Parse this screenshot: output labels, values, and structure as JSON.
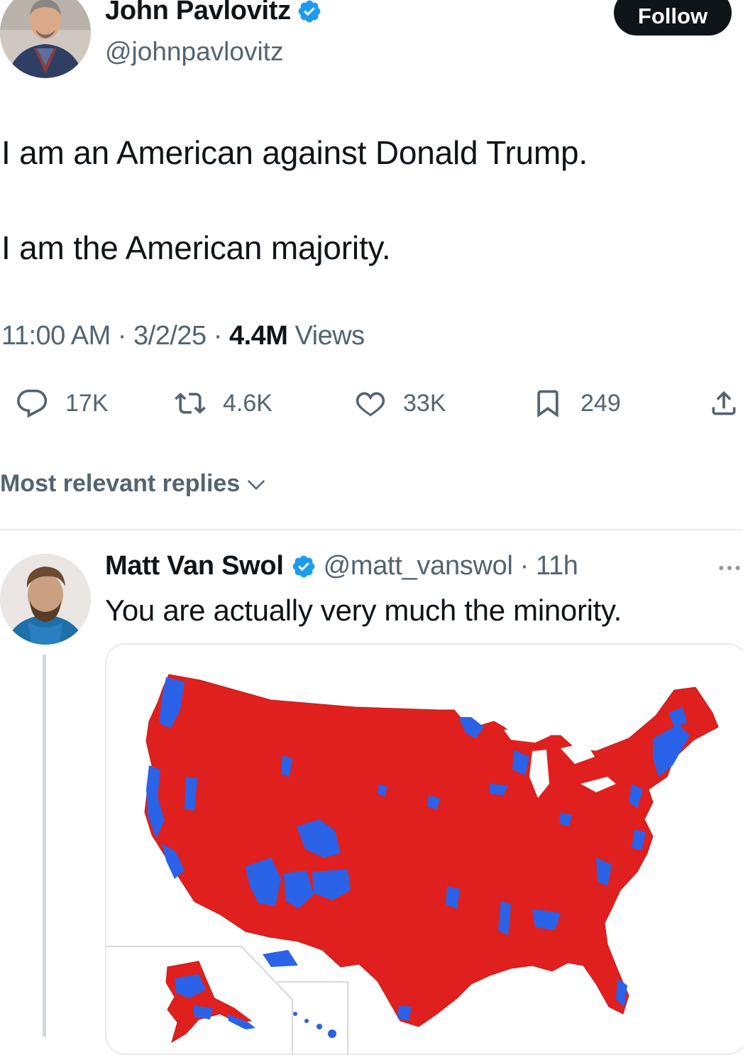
{
  "tweet": {
    "author": {
      "name": "John Pavlovitz",
      "handle": "@johnpavlovitz",
      "verified": true
    },
    "follow_label": "Follow",
    "text_lines": [
      "I am an American against Donald Trump.",
      "I am the American majority."
    ],
    "time": "11:00 AM",
    "date": "3/2/25",
    "views_count": "4.4M",
    "views_label": "Views",
    "sep": "·",
    "stats": {
      "replies": "17K",
      "reposts": "4.6K",
      "likes": "33K",
      "bookmarks": "249"
    }
  },
  "replies_sort_label": "Most relevant replies",
  "reply": {
    "name": "Matt Van Swol",
    "handle": "@matt_vanswol",
    "sep": "·",
    "age": "11h",
    "verified": true,
    "text": "You are actually very much the minority."
  },
  "colors": {
    "text": "#0f1419",
    "secondary": "#536471",
    "verified": "#1d9bf0",
    "map_red": "#e0201e",
    "map_blue": "#2a62e8"
  },
  "icons": [
    "reply-icon",
    "retweet-icon",
    "like-icon",
    "bookmark-icon",
    "share-icon",
    "chevron-down-icon",
    "verified-badge-icon",
    "more-icon"
  ]
}
